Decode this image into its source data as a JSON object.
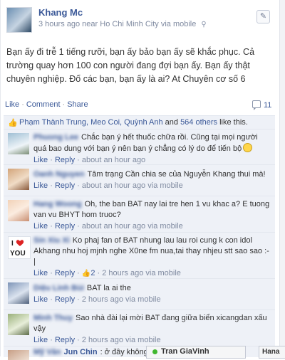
{
  "post": {
    "author": "Khang Mc",
    "time": "3 hours ago",
    "location": "near Ho Chi Minh City",
    "via": "via mobile",
    "text": "Bạn ấy đi trễ 1 tiếng rưỡi, bạn ấy bảo bạn ấy sẽ khắc phục. Cả trường quay hơn 100 con người đang đợi bạn ấy. Bạn ấy thật chuyên nghiệp. Đố các bạn, bạn ấy là ai? At Chuyên cơ số 6",
    "actions": {
      "like": "Like",
      "comment": "Comment",
      "share": "Share"
    },
    "comment_count": "11",
    "likes_text": {
      "names": "Phạm Thành Trung, Meo Coi, Quỳnh Anh",
      "and": " and ",
      "others": "564 others",
      "suffix": " like this."
    }
  },
  "comments": [
    {
      "name": "Phuong Lee",
      "text": "Chắc bạn ý hết thuốc chữa rồi. Cũng tại mọi người quá bao dung với bạn ý nên bạn ý chẳng có lý do để tiến bộ",
      "like": "Like",
      "reply": "Reply",
      "time": "about an hour ago",
      "via": ""
    },
    {
      "name": "Oanh Nguyen",
      "text": "Tâm trạng Cần chia se của Nguyễn Khang thui mà!",
      "like": "Like",
      "reply": "Reply",
      "time": "about an hour ago",
      "via": "via mobile"
    },
    {
      "name": "Hang Woong",
      "text": "Oh, the ban BAT nay lai tre hen 1 vu khac a? E tuong van vu BHYT hom truoc?",
      "like": "Like",
      "reply": "Reply",
      "time": "about an hour ago",
      "via": "via mobile"
    },
    {
      "name": "Sin Xiu Xi",
      "text": "Ko phaj fan of BAT nhung lau lau roi cung k con idol Akhang nhu hoj mjnh nghe X0ne fm nua,tai thay nhjeu stt sao sao :-|",
      "like": "Like",
      "reply": "Reply",
      "likes": "2",
      "time": "2 hours ago",
      "via": "via mobile"
    },
    {
      "name": "Diệu Linh Bùi",
      "text": "BAT la ai the",
      "like": "Like",
      "reply": "Reply",
      "time": "2 hours ago",
      "via": "via mobile"
    },
    {
      "name": "Minh Thuy",
      "text": "Sao nhà đài lại mời BAT đang giữa biển xicangdan xấu vậy",
      "like": "Like",
      "reply": "Reply",
      "time": "2 hours ago",
      "via": "via mobile"
    },
    {
      "name": "Mỹ Vân",
      "nick": "Jun Chin",
      "text": ": ở đây không ph",
      "like": "",
      "reply": "",
      "time": "",
      "via": ""
    }
  ],
  "chat": {
    "name": "Tran GiaVinh",
    "name2": "Hana"
  },
  "colors": {
    "link": "#3b5998",
    "comment_bg": "#eef1f7",
    "online": "#41b72f"
  }
}
